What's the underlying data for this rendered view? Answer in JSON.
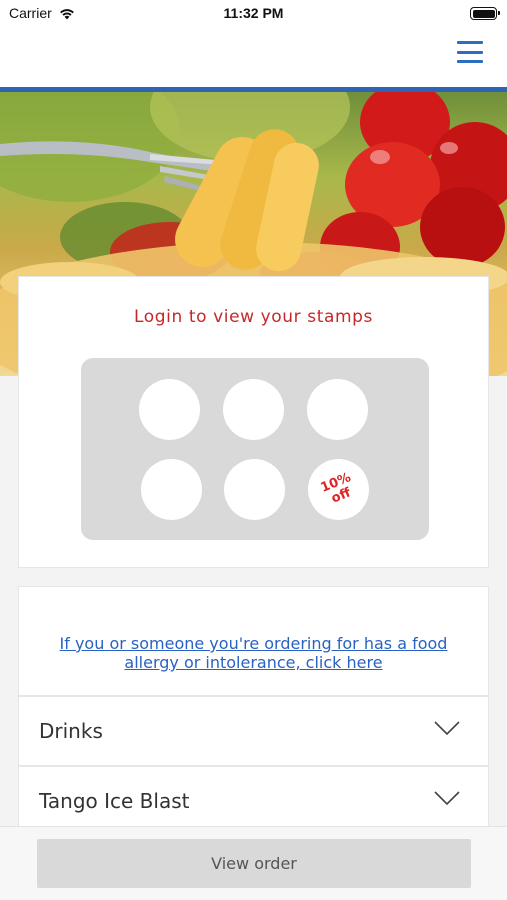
{
  "status_bar": {
    "carrier": "Carrier",
    "time": "11:32 PM",
    "wifi_icon": "wifi-icon",
    "battery_icon": "battery-icon"
  },
  "header": {
    "menu_icon": "hamburger-menu-icon",
    "accent_color": "#2f64b4"
  },
  "hero": {
    "image": "pasta-fork-tomatoes-photo"
  },
  "loyalty": {
    "title": "Login to view your stamps",
    "title_color": "#c62828",
    "reward_text": "10% off",
    "stamps_total": 6,
    "stamps_filled": 0
  },
  "allergy": {
    "link_text": "If you or someone you're ordering for has a food allergy or intolerance, click here",
    "link_color": "#2962c4"
  },
  "categories": [
    {
      "label": "Drinks",
      "icon": "chevron-down-icon"
    },
    {
      "label": "Tango Ice Blast",
      "icon": "chevron-down-icon"
    }
  ],
  "footer": {
    "view_order_label": "View order"
  }
}
